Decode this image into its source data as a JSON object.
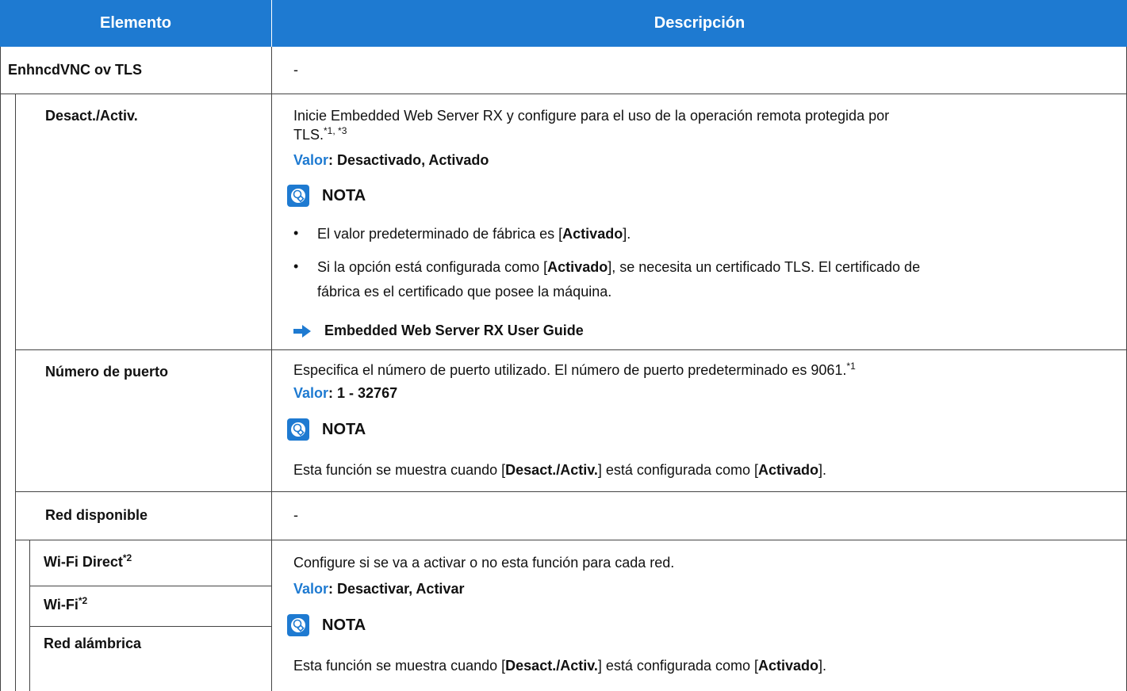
{
  "header": {
    "col1": "Elemento",
    "col2": "Descripción"
  },
  "rows": {
    "r1": {
      "label": "EnhncdVNC ov TLS",
      "desc": "-"
    },
    "r2": {
      "label": "Desact./Activ.",
      "desc_line1": "Inicie Embedded Web Server RX y configure para el uso de la operación remota protegida por",
      "desc_line2": "TLS.",
      "desc_sup": "*1, *3",
      "valor_label": "Valor",
      "valor_value": ": Desactivado, Activado",
      "nota": "NOTA",
      "b1_pre": "El valor predeterminado de fábrica es [",
      "b1_bold": "Activado",
      "b1_post": "].",
      "b2_pre": "Si la opción está configurada como [",
      "b2_bold": "Activado",
      "b2_post": "], se necesita un certificado TLS. El certificado de",
      "b2_line2": "fábrica es el certificado que posee la máquina.",
      "link": "Embedded Web Server RX User Guide"
    },
    "r3": {
      "label": "Número de puerto",
      "desc": "Especifica el número de puerto utilizado. El número de puerto predeterminado es 9061.",
      "desc_sup": "*1",
      "valor_label": "Valor",
      "valor_value": ": 1 - 32767",
      "nota": "NOTA",
      "n_pre": "Esta función se muestra cuando [",
      "n_b1": "Desact./Activ.",
      "n_mid": "] está configurada como [",
      "n_b2": "Activado",
      "n_post": "]."
    },
    "r4": {
      "label": "Red disponible",
      "desc": "-"
    },
    "r5": {
      "label_a": "Wi-Fi Direct",
      "label_a_sup": "*2",
      "label_b": "Wi-Fi",
      "label_b_sup": "*2",
      "label_c": "Red alámbrica",
      "desc": "Configure si se va a activar o no esta función para cada red.",
      "valor_label": "Valor",
      "valor_value": ": Desactivar, Activar",
      "nota": "NOTA",
      "n_pre": "Esta función se muestra cuando [",
      "n_b1": "Desact./Activ.",
      "n_mid": "] está configurada como [",
      "n_b2": "Activado",
      "n_post": "]."
    }
  },
  "colors": {
    "accent": "#1e7ad1",
    "border": "#444444"
  },
  "icons": {
    "nota": "lightbulb-note-icon",
    "link": "arrow-right-icon"
  }
}
